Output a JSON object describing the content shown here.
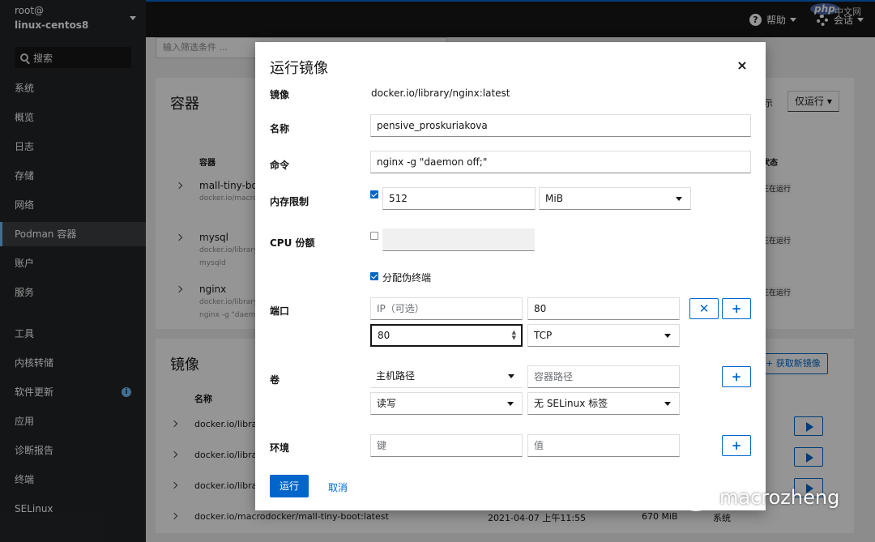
{
  "sidebar": {
    "user": "root@",
    "host": "linux-centos8",
    "search": "搜索",
    "items": [
      "系统",
      "概览",
      "日志",
      "存储",
      "网络",
      "Podman 容器",
      "账户",
      "服务",
      "工具",
      "内核转储",
      "软件更新",
      "应用",
      "诊断报告",
      "终端",
      "SELinux"
    ]
  },
  "topbar": {
    "help": "帮助",
    "session": "会话",
    "php_badge": "php",
    "php_site": "中文网"
  },
  "background": {
    "filter_placeholder": "输入筛选条件 ...",
    "containers_title": "容器",
    "show_label": "显示",
    "show_option": "仅运行",
    "col_container": "容器",
    "col_state": "状态",
    "containers": [
      {
        "name": "mall-tiny-bo",
        "image": "docker.io/macro",
        "state": "正在运行"
      },
      {
        "name": "mysql",
        "image": "docker.io/library/",
        "cmd": "mysqld",
        "state": "正在运行"
      },
      {
        "name": "nginx",
        "image": "docker.io/library/",
        "cmd": "nginx -g \"daemo",
        "state": "正在运行"
      }
    ],
    "images_title": "镜像",
    "get_image": "获取新镜像",
    "col_name": "名称",
    "images": [
      {
        "name": "docker.io/library"
      },
      {
        "name": "docker.io/library"
      },
      {
        "name": "docker.io/library"
      },
      {
        "name": "docker.io/macrodocker/mall-tiny-boot:latest",
        "date": "2021-04-07 上午11:55",
        "size": "670 MiB",
        "owner": "系统"
      }
    ]
  },
  "modal": {
    "title": "运行镜像",
    "labels": {
      "image": "镜像",
      "name": "名称",
      "command": "命令",
      "memory": "内存限制",
      "cpu": "CPU 份额",
      "ports": "端口",
      "volumes": "卷",
      "env": "环境"
    },
    "image_value": "docker.io/library/nginx:latest",
    "name_value": "pensive_proskuriakova",
    "command_value": "nginx -g \"daemon off;\"",
    "memory": {
      "checked": true,
      "value": "512",
      "unit": "MiB"
    },
    "cpu": {
      "checked": false,
      "value": ""
    },
    "tty": {
      "checked": true,
      "label": "分配伪终端"
    },
    "ports": {
      "ip_placeholder": "IP（可选）",
      "host_port": "80",
      "container_port": "80",
      "protocol": "TCP"
    },
    "volumes": {
      "host_path": "主机路径",
      "container_path_placeholder": "容器路径",
      "mode": "读写",
      "selinux": "无 SELinux 标签"
    },
    "env": {
      "key_placeholder": "键",
      "value_placeholder": "值"
    },
    "run": "运行",
    "cancel": "取消",
    "close": "×"
  },
  "watermark": "macrozheng"
}
